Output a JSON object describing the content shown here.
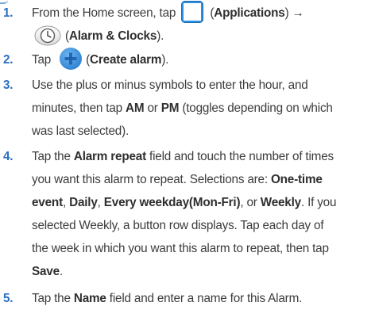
{
  "colors": {
    "number": "#2a6ec1",
    "icon_blue": "#2f8fe0",
    "text": "#3c3c3c"
  },
  "icons": [
    "applications-icon",
    "alarm-clock-icon",
    "create-alarm-icon"
  ],
  "steps": [
    {
      "number": "1.",
      "t1": "From the Home screen, tap",
      "t2": "(",
      "t3": "Applications",
      "t4": ") →",
      "t5": "(",
      "t6": "Alarm & Clocks",
      "t7": ")."
    },
    {
      "number": "2.",
      "t1": "Tap",
      "t2": "(",
      "t3": "Create alarm",
      "t4": ")."
    },
    {
      "number": "3.",
      "l1": "Use the plus or minus symbols to enter the hour, and",
      "l2a": "minutes, then tap",
      "l2b": "AM",
      "l2c": "or",
      "l2d": "PM",
      "l2e": "(toggles depending on which",
      "l3": "was last selected)."
    },
    {
      "number": "4.",
      "l1a": "Tap the",
      "l1b": "Alarm repeat",
      "l1c": "field and touch the number of times",
      "l2": "you want this alarm to repeat. Selections are:",
      "l2b": "One-time",
      "l3a": "event",
      "l3b": ",",
      "l3c": "Daily",
      "l3d": ",",
      "l3e": "Every weekday(Mon-Fri)",
      "l3f": ", or",
      "l3g": "Weekly",
      "l3h": ". If you",
      "l4": "selected Weekly, a button row displays. Tap each day of",
      "l5": "the week in which you want this alarm to repeat, then tap",
      "l6a": "Save",
      "l6b": "."
    },
    {
      "number": "5.",
      "l1a": "Tap the",
      "l1b": "Name",
      "l1c": "field and enter a name for this Alarm."
    }
  ]
}
